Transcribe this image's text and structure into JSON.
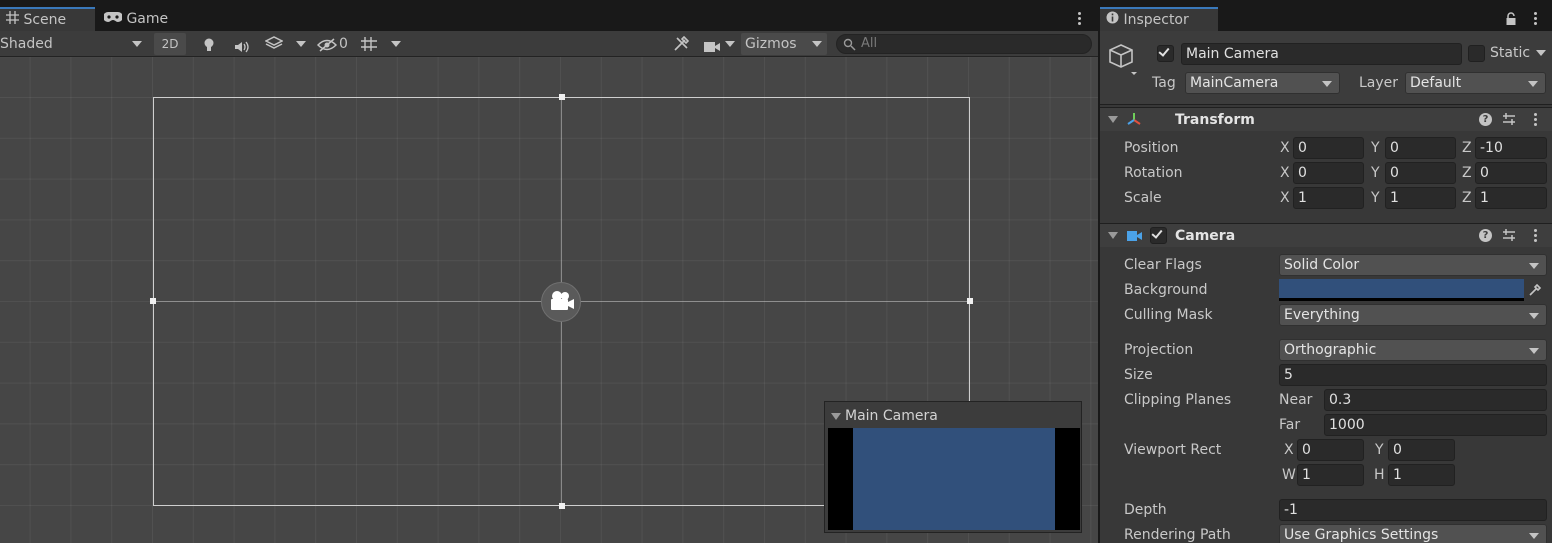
{
  "scene": {
    "tabs": [
      {
        "label": "Scene"
      },
      {
        "label": "Game"
      }
    ],
    "toolbar": {
      "draw_mode": "Shaded",
      "mode_2d": "2D",
      "hidden_count": "0",
      "gizmos": "Gizmos",
      "search_placeholder": "All"
    },
    "camera_preview": {
      "title": "Main Camera",
      "background_color": "#31507b"
    }
  },
  "inspector": {
    "tab_label": "Inspector",
    "object": {
      "active": true,
      "name": "Main Camera",
      "static_label": "Static",
      "static": false,
      "tag_label": "Tag",
      "tag": "MainCamera",
      "layer_label": "Layer",
      "layer": "Default"
    },
    "transform": {
      "title": "Transform",
      "rows": [
        {
          "label": "Position",
          "x": "0",
          "y": "0",
          "z": "-10"
        },
        {
          "label": "Rotation",
          "x": "0",
          "y": "0",
          "z": "0"
        },
        {
          "label": "Scale",
          "x": "1",
          "y": "1",
          "z": "1"
        }
      ],
      "axes": {
        "x": "X",
        "y": "Y",
        "z": "Z"
      }
    },
    "camera": {
      "title": "Camera",
      "enabled": true,
      "clear_flags_label": "Clear Flags",
      "clear_flags": "Solid Color",
      "background_label": "Background",
      "background_color": "#31507b",
      "culling_mask_label": "Culling Mask",
      "culling_mask": "Everything",
      "projection_label": "Projection",
      "projection": "Orthographic",
      "size_label": "Size",
      "size": "5",
      "clipping_label": "Clipping Planes",
      "near_label": "Near",
      "near": "0.3",
      "far_label": "Far",
      "far": "1000",
      "viewport_label": "Viewport Rect",
      "viewport": {
        "x_label": "X",
        "x": "0",
        "y_label": "Y",
        "y": "0",
        "w_label": "W",
        "w": "1",
        "h_label": "H",
        "h": "1"
      },
      "depth_label": "Depth",
      "depth": "-1",
      "rendering_path_label": "Rendering Path",
      "rendering_path": "Use Graphics Settings"
    }
  }
}
